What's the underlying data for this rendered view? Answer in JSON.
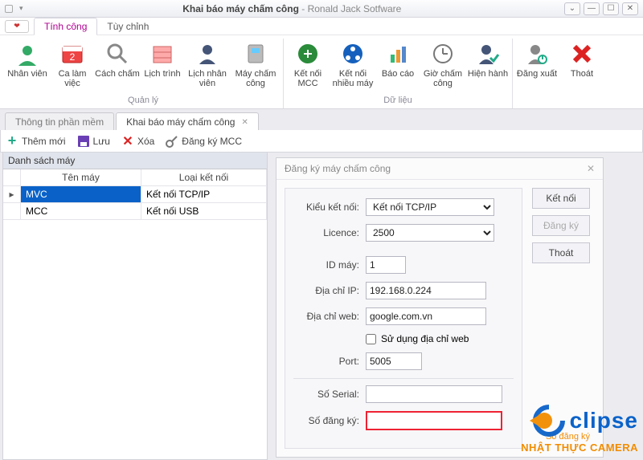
{
  "window": {
    "app_title": "Khai báo máy chấm công",
    "app_subtitle": "Ronald Jack Sotfware"
  },
  "qat": {
    "tab_active": "Tính công",
    "tab_2": "Tùy chỉnh"
  },
  "ribbon": {
    "group_manage": "Quản lý",
    "group_data": "Dữ liệu",
    "nhan_vien": "Nhân viên",
    "ca_lam_viec": "Ca làm việc",
    "cach_cham": "Cách chấm",
    "lich_trinh": "Lịch trình",
    "lich_nhan_vien": "Lịch nhân viên",
    "may_cham_cong": "Máy chấm công",
    "ket_noi_mcc": "Kết nối MCC",
    "ket_noi_nhieu_may": "Kết nối nhiều máy",
    "bao_cao": "Báo cáo",
    "gio_cham_cong": "Giờ chấm công",
    "hien_hanh": "Hiện hành",
    "dang_xuat": "Đăng xuất",
    "thoat": "Thoát"
  },
  "doctabs": {
    "tab1": "Thông tin phần mềm",
    "tab2": "Khai báo máy chấm công"
  },
  "toolbar": {
    "add": "Thêm mới",
    "save": "Lưu",
    "delete": "Xóa",
    "register": "Đăng ký MCC"
  },
  "list": {
    "title": "Danh sách máy",
    "col_name": "Tên máy",
    "col_type": "Loại kết nối",
    "rows": [
      {
        "name": "MVC",
        "type": "Kết nối TCP/IP"
      },
      {
        "name": "MCC",
        "type": "Kết nối USB"
      }
    ]
  },
  "dialog": {
    "title": "Đăng ký máy chấm công",
    "lbl_kieu": "Kiểu kết nối:",
    "val_kieu": "Kết nối TCP/IP",
    "lbl_licence": "Licence:",
    "val_licence": "2500",
    "lbl_id": "ID máy:",
    "val_id": "1",
    "lbl_ip": "Địa chỉ IP:",
    "val_ip": "192.168.0.224",
    "lbl_web": "Địa chỉ web:",
    "val_web": "google.com.vn",
    "lbl_use_web": "Sử dụng địa chỉ web",
    "lbl_port": "Port:",
    "val_port": "5005",
    "lbl_serial": "Số Serial:",
    "val_serial": "",
    "lbl_reg": "Số đăng ký:",
    "val_reg": "",
    "btn_connect": "Kết nối",
    "btn_register": "Đăng ký",
    "btn_exit": "Thoát"
  },
  "watermark": {
    "brand": "clipse",
    "sub": "NHẬT THỰC CAMERA",
    "hidden": "Số đăng ký"
  }
}
